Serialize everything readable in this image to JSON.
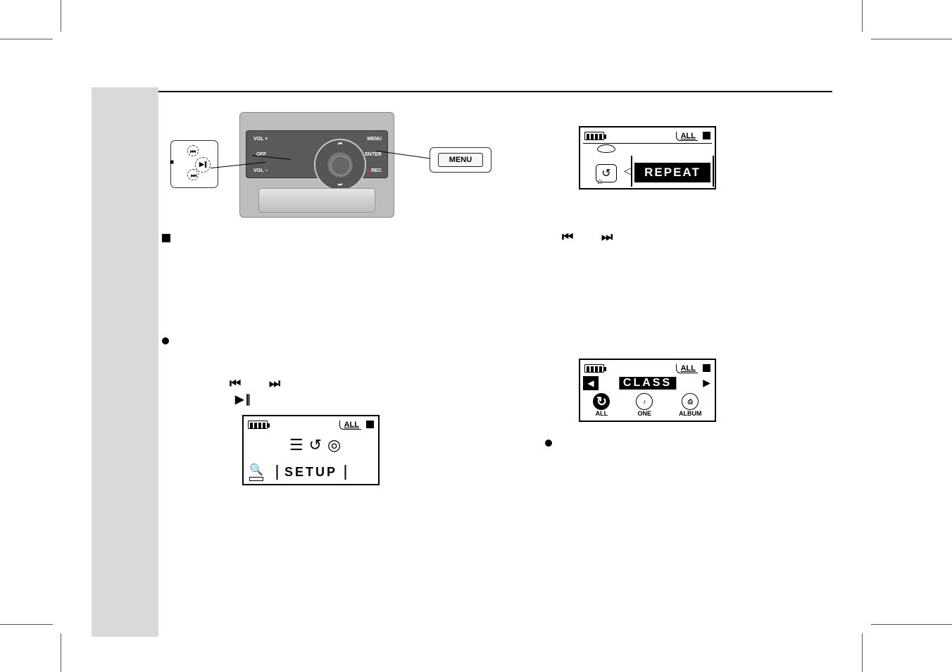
{
  "device": {
    "nav": {
      "up_glyph": "⏮",
      "down_glyph": "⏭",
      "center_glyph": "▶∥"
    },
    "labels": {
      "vol_plus": "VOL +",
      "off": "OFF",
      "vol_minus": "VOL –",
      "menu": "MENU",
      "enter": "ENTER",
      "rec": "REC"
    },
    "callout_dial": {
      "top_glyph": "⏮",
      "mid_glyph": "▶∥",
      "bot_glyph": "⏭",
      "stop_glyph": "■"
    },
    "callout_menu_label": "MENU"
  },
  "inline_glyphs": {
    "skip_back": "⏮",
    "skip_fwd": "⏭",
    "play_pause": "▶∥"
  },
  "lcd_common": {
    "mode_all": "ALL"
  },
  "lcd_setup": {
    "title": "SETUP"
  },
  "lcd_repeat": {
    "title": "REPEAT",
    "pointer": "◁"
  },
  "lcd_class": {
    "title": "CLASS",
    "left_arrow": "◀",
    "right_arrow": "▶",
    "options": {
      "all": "ALL",
      "one": "ONE",
      "album": "ALBUM"
    },
    "note_glyph": "♪",
    "album_glyph": "⎙"
  }
}
